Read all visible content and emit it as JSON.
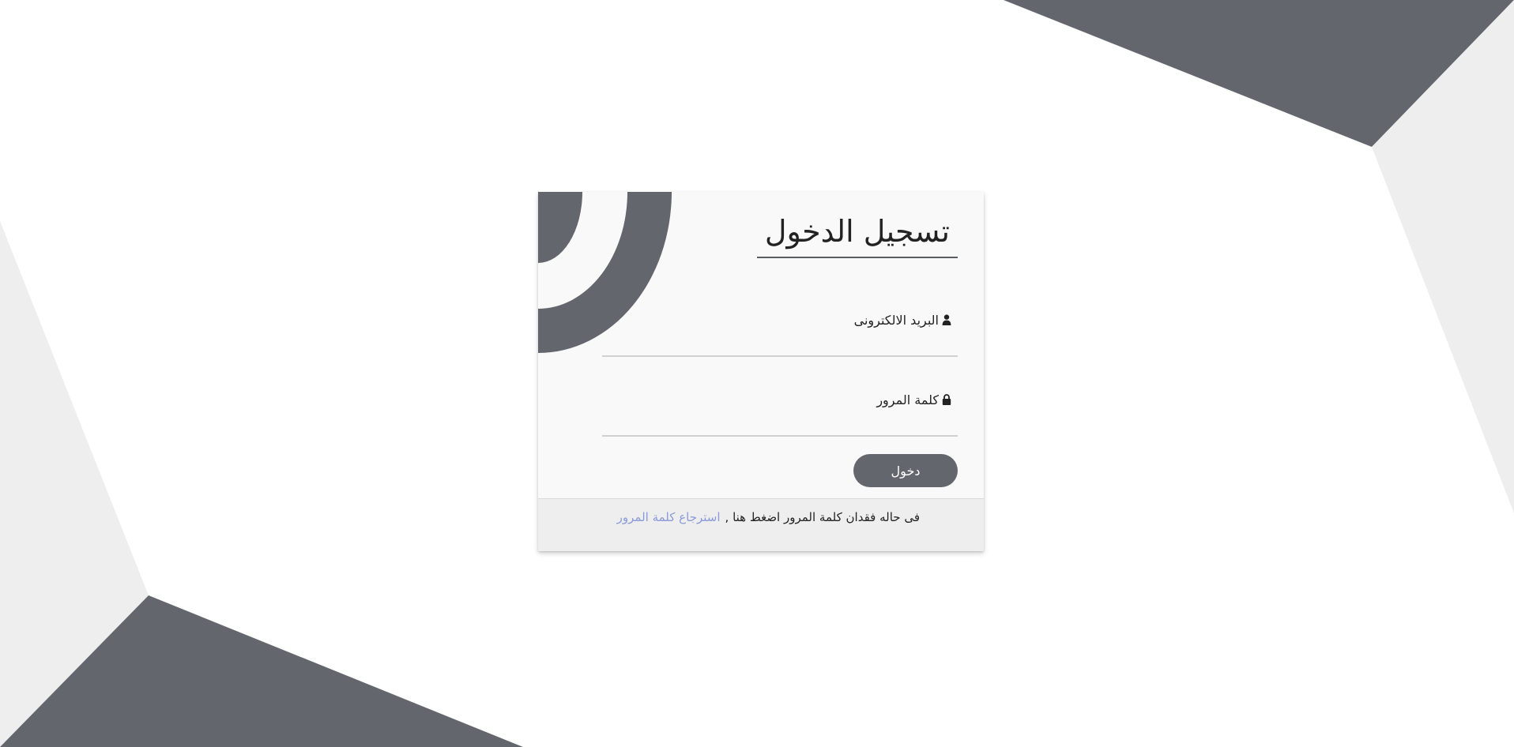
{
  "login": {
    "title": "تسجيل الدخول",
    "email_label": "البريد الالكترونى",
    "email_value": "",
    "password_label": "كلمة المرور",
    "password_value": "",
    "submit_label": "دخول"
  },
  "footer": {
    "text": "فى حاله فقدان كلمة المرور اضغط هنا ,",
    "link_text": "استرجاع كلمة المرور"
  },
  "icons": {
    "email": "user-icon",
    "password": "lock-icon"
  },
  "colors": {
    "accent": "#63676d",
    "background_shape_light": "#eeeeee",
    "card_background": "#f9f9f9",
    "footer_background": "#eeeeee",
    "link": "#8a9ad8"
  }
}
